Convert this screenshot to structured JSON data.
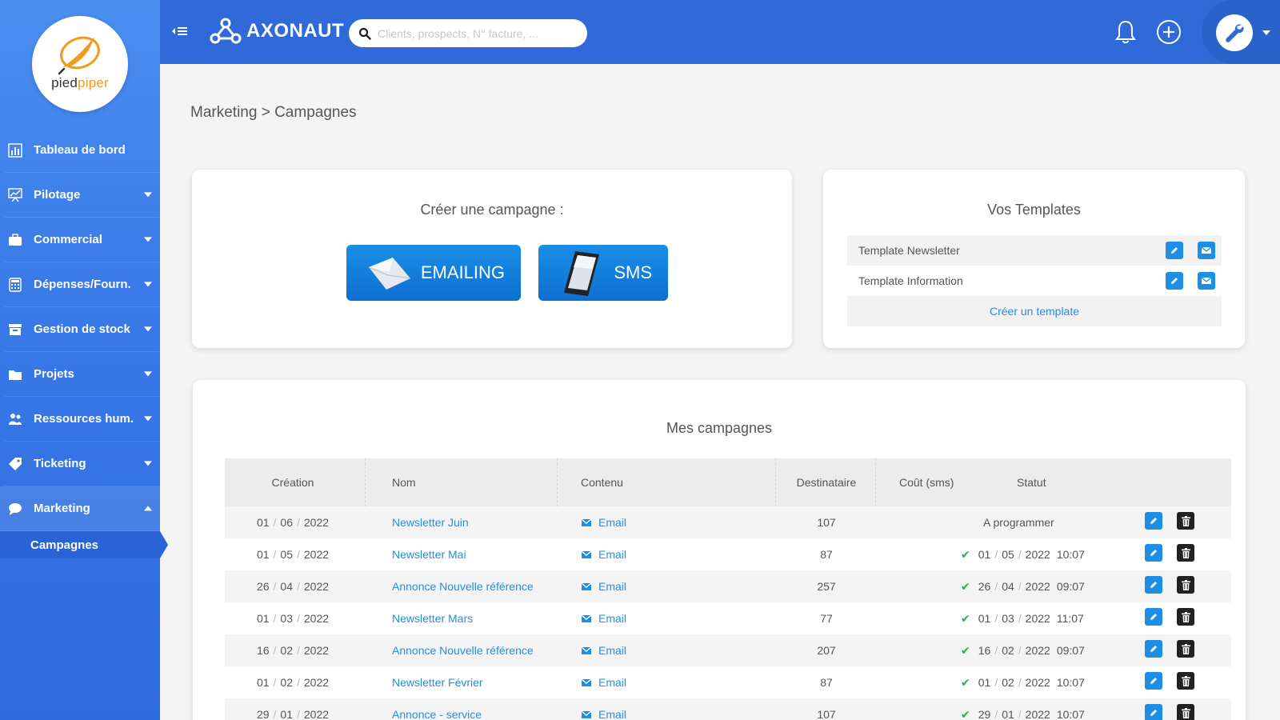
{
  "sidebar": {
    "logo": {
      "part1": "pied",
      "part2": "piper"
    },
    "items": [
      {
        "label": "Tableau de bord",
        "icon": "chart-bar-icon",
        "caret": false
      },
      {
        "label": "Pilotage",
        "icon": "presentation-chart-icon",
        "caret": true
      },
      {
        "label": "Commercial",
        "icon": "briefcase-icon",
        "caret": true
      },
      {
        "label": "Dépenses/Fourn.",
        "icon": "calculator-icon",
        "caret": true
      },
      {
        "label": "Gestion de stock",
        "icon": "archive-box-icon",
        "caret": true
      },
      {
        "label": "Projets",
        "icon": "folder-icon",
        "caret": true
      },
      {
        "label": "Ressources hum.",
        "icon": "users-icon",
        "caret": true
      },
      {
        "label": "Ticketing",
        "icon": "tag-icon",
        "caret": true
      },
      {
        "label": "Marketing",
        "icon": "speech-bubble-icon",
        "caret": true,
        "expanded": true
      }
    ],
    "sub_item": "Campagnes"
  },
  "topbar": {
    "brand": "AXONAUT",
    "search_placeholder": "Clients, prospects, N° facture, ..."
  },
  "breadcrumb": "Marketing > Campagnes",
  "create_card": {
    "title": "Créer une campagne :",
    "email_button": "EMAILING",
    "sms_button": "SMS"
  },
  "templates_card": {
    "title": "Vos Templates",
    "templates": [
      "Template Newsletter",
      "Template Information"
    ],
    "create_label": "Créer un template"
  },
  "campaigns": {
    "title": "Mes campagnes",
    "headers": {
      "creation": "Création",
      "nom": "Nom",
      "contenu": "Contenu",
      "destinataire": "Destinataire",
      "cout": "Coût (sms)",
      "statut": "Statut"
    },
    "rows": [
      {
        "d": "01",
        "m": "06",
        "y": "2022",
        "nom": "Newsletter Juin",
        "contenu": "Email",
        "dest": "107",
        "status_text": "A programmer",
        "sd": "",
        "sm": "",
        "sy": "",
        "st": ""
      },
      {
        "d": "01",
        "m": "05",
        "y": "2022",
        "nom": "Newsletter Mai",
        "contenu": "Email",
        "dest": "87",
        "status_text": "",
        "sd": "01",
        "sm": "05",
        "sy": "2022",
        "st": "10:07"
      },
      {
        "d": "26",
        "m": "04",
        "y": "2022",
        "nom": "Annonce Nouvelle référence",
        "contenu": "Email",
        "dest": "257",
        "status_text": "",
        "sd": "26",
        "sm": "04",
        "sy": "2022",
        "st": "09:07"
      },
      {
        "d": "01",
        "m": "03",
        "y": "2022",
        "nom": "Newsletter Mars",
        "contenu": "Email",
        "dest": "77",
        "status_text": "",
        "sd": "01",
        "sm": "03",
        "sy": "2022",
        "st": "11:07"
      },
      {
        "d": "16",
        "m": "02",
        "y": "2022",
        "nom": "Annonce Nouvelle référence",
        "contenu": "Email",
        "dest": "207",
        "status_text": "",
        "sd": "16",
        "sm": "02",
        "sy": "2022",
        "st": "09:07"
      },
      {
        "d": "01",
        "m": "02",
        "y": "2022",
        "nom": "Newsletter Février",
        "contenu": "Email",
        "dest": "87",
        "status_text": "",
        "sd": "01",
        "sm": "02",
        "sy": "2022",
        "st": "10:07"
      },
      {
        "d": "29",
        "m": "01",
        "y": "2022",
        "nom": "Annonce - service",
        "contenu": "Email",
        "dest": "107",
        "status_text": "",
        "sd": "29",
        "sm": "01",
        "sy": "2022",
        "st": "10:07"
      }
    ]
  },
  "colors": {
    "sidebar": "#3a7ae8",
    "topbar": "#2f6ad8",
    "accent": "#1e8fe6",
    "success": "#22b14c",
    "logo_orange": "#f29a1d"
  }
}
